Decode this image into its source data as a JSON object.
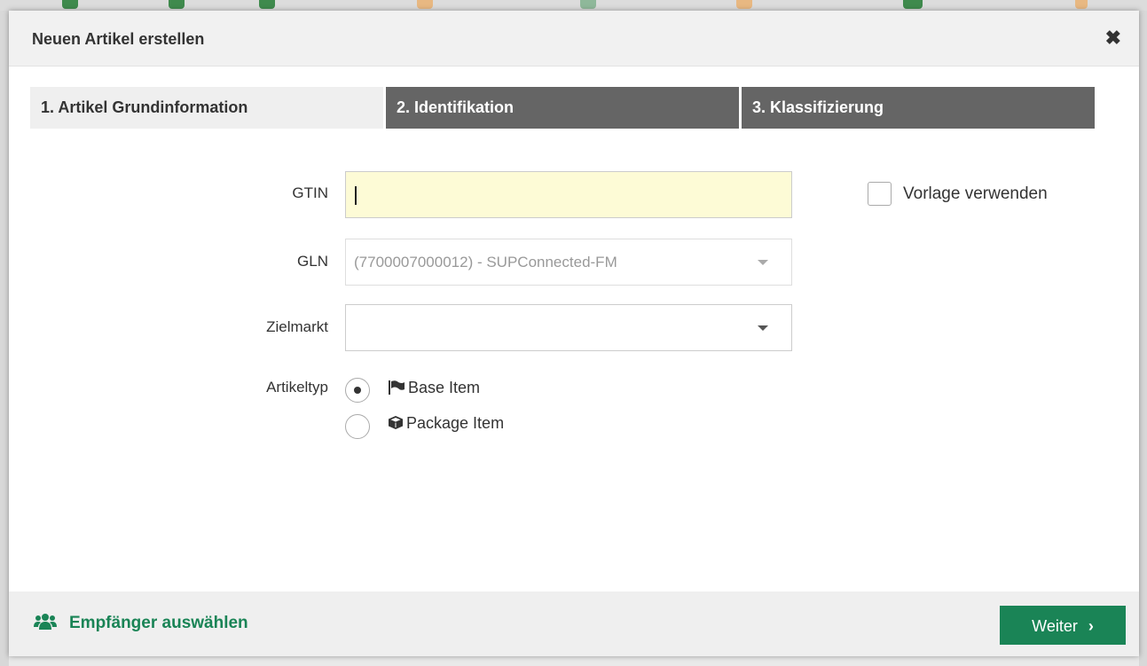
{
  "modal": {
    "title": "Neuen Artikel erstellen",
    "close_icon": "close-icon"
  },
  "steps": [
    {
      "label": "1. Artikel Grundinformation",
      "active": true
    },
    {
      "label": "2. Identifikation",
      "active": false
    },
    {
      "label": "3. Klassifizierung",
      "active": false
    }
  ],
  "form": {
    "gtin": {
      "label": "GTIN",
      "value": ""
    },
    "gln": {
      "label": "GLN",
      "value": "(7700007000012) - SUPConnected-FM"
    },
    "zielmarkt": {
      "label": "Zielmarkt",
      "value": ""
    },
    "artikeltyp": {
      "label": "Artikeltyp",
      "options": [
        {
          "label": "Base Item",
          "icon": "flag-icon",
          "selected": true
        },
        {
          "label": "Package Item",
          "icon": "cube-icon",
          "selected": false
        }
      ]
    },
    "template_checkbox": {
      "label": "Vorlage verwenden",
      "checked": false
    }
  },
  "footer": {
    "recipients_label": "Empfänger auswählen",
    "recipients_icon": "users-icon",
    "next_label": "Weiter"
  },
  "colors": {
    "accent_green": "#1a8456",
    "inactive_step": "#656565",
    "gtin_bg": "#fdfbd6"
  }
}
